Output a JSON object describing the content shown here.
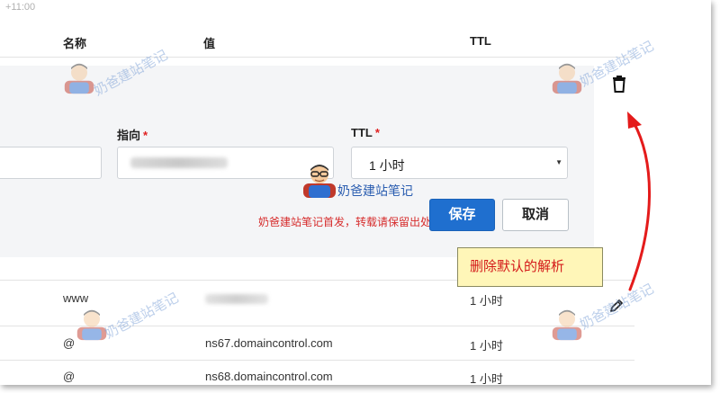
{
  "top_note": "+11:00",
  "columns": {
    "name": "名称",
    "value": "值",
    "ttl": "TTL"
  },
  "edit_form": {
    "target_label": "指向",
    "ttl_label": "TTL",
    "required_mark": "*",
    "ttl_selected": "1 小时",
    "save_label": "保存",
    "cancel_label": "取消"
  },
  "watermark": {
    "brand": "奶爸建站笔记",
    "notice": "奶爸建站笔记首发，转载请保留出处"
  },
  "tooltip": "删除默认的解析",
  "rows": [
    {
      "name": "www",
      "value": "",
      "ttl": "1 小时"
    },
    {
      "name": "@",
      "value": "ns67.domaincontrol.com",
      "ttl": "1 小时"
    },
    {
      "name": "@",
      "value": "ns68.domaincontrol.com",
      "ttl": "1 小时"
    }
  ],
  "icons": {
    "delete": "trash-icon",
    "edit": "pencil-icon",
    "select_caret": "caret-down-icon",
    "annotation": "red-curved-arrow"
  },
  "colors": {
    "accent": "#1f6fcf",
    "annotation_red": "#e41b1b",
    "tooltip_bg": "#fff6b8",
    "watermark": "#7a9fd6"
  }
}
